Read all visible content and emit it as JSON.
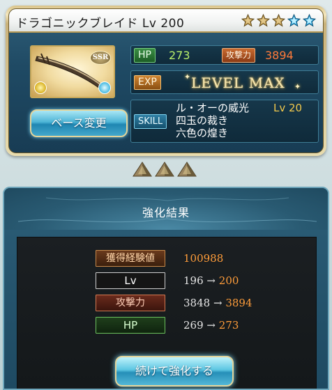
{
  "weapon": {
    "title": "ドラゴニックブレイド Lv 200",
    "rarity": "SSR",
    "stars": [
      "gold",
      "gold",
      "gold",
      "blue",
      "blue"
    ],
    "hp_label": "HP",
    "hp_value": "273",
    "atk_label": "攻撃力",
    "atk_value": "3894",
    "exp_label": "EXP",
    "level_max": "LEVEL MAX",
    "skill_label": "SKILL",
    "skills": [
      {
        "name": "ル・オーの威光",
        "level": "Lv 20"
      },
      {
        "name": "四玉の裁き"
      },
      {
        "name": "六色の煌き"
      }
    ],
    "base_change_button": "ベース変更"
  },
  "result": {
    "title": "強化結果",
    "exp_label": "獲得経験値",
    "exp_value": "100988",
    "lv_label": "Lv",
    "lv_before": "196",
    "lv_after": "200",
    "atk_label": "攻撃力",
    "atk_before": "3848",
    "atk_after": "3894",
    "hp_label": "HP",
    "hp_before": "269",
    "hp_after": "273",
    "arrow": "→",
    "continue_button": "続けて強化する"
  },
  "colors": {
    "gold_star": "#c8a24a",
    "blue_star": "#3fb5e8",
    "highlight": "#ff9d3a",
    "panel": "#1e4a62"
  }
}
